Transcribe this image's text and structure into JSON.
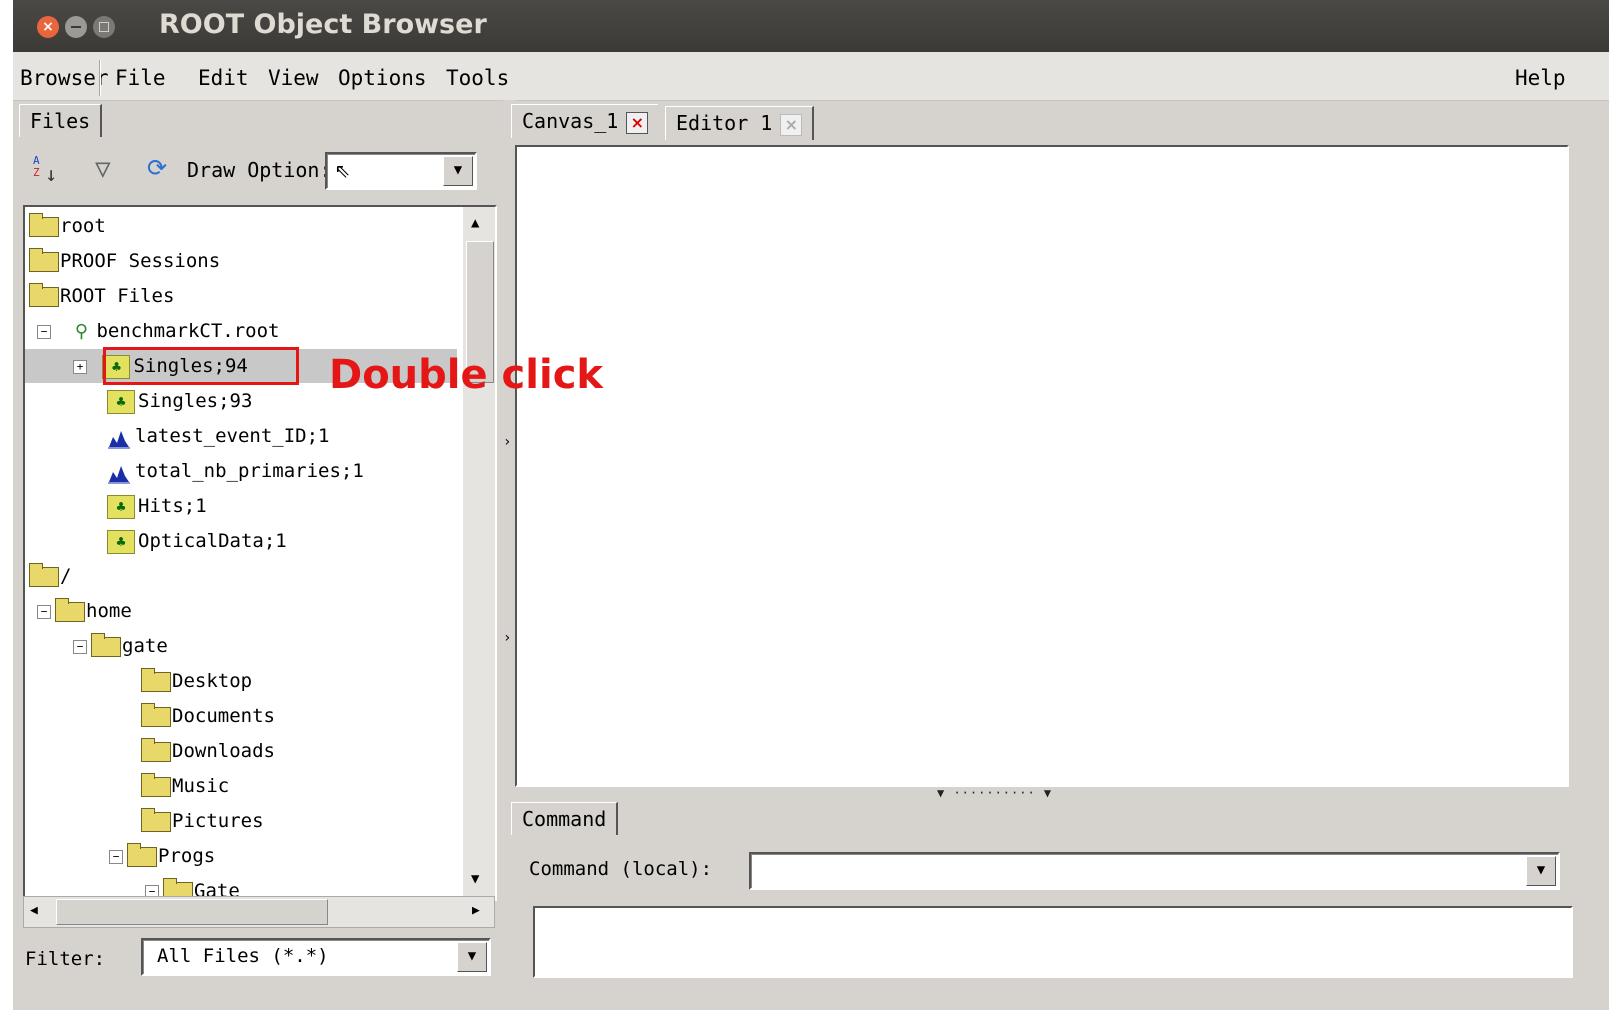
{
  "window": {
    "title": "ROOT Object Browser"
  },
  "menubar": {
    "items": [
      "Browser",
      "File",
      "Edit",
      "View",
      "Options",
      "Tools"
    ],
    "help": "Help"
  },
  "left_panel": {
    "tab": "Files",
    "draw_option_label": "Draw Option:",
    "tree": [
      {
        "label": "root",
        "icon": "folder-icon"
      },
      {
        "label": "PROOF Sessions",
        "icon": "folder-icon"
      },
      {
        "label": "ROOT Files",
        "icon": "folder-open-icon"
      },
      {
        "label": "benchmarkCT.root",
        "icon": "root-file-icon"
      },
      {
        "label": "Singles;94",
        "icon": "tree-icon",
        "selected": true
      },
      {
        "label": "Singles;93",
        "icon": "tree-icon"
      },
      {
        "label": "latest_event_ID;1",
        "icon": "histogram-icon"
      },
      {
        "label": "total_nb_primaries;1",
        "icon": "histogram-icon"
      },
      {
        "label": "Hits;1",
        "icon": "tree-icon"
      },
      {
        "label": "OpticalData;1",
        "icon": "tree-icon"
      },
      {
        "label": "/",
        "icon": "folder-open-icon"
      },
      {
        "label": "home",
        "icon": "folder-open-icon"
      },
      {
        "label": "gate",
        "icon": "folder-open-icon"
      },
      {
        "label": "Desktop",
        "icon": "folder-icon"
      },
      {
        "label": "Documents",
        "icon": "folder-icon"
      },
      {
        "label": "Downloads",
        "icon": "folder-icon"
      },
      {
        "label": "Music",
        "icon": "folder-icon"
      },
      {
        "label": "Pictures",
        "icon": "folder-icon"
      },
      {
        "label": "Progs",
        "icon": "folder-open-icon"
      },
      {
        "label": "Gate",
        "icon": "folder-open-icon"
      }
    ],
    "filter_label": "Filter:",
    "filter_value": "All Files (*.*)"
  },
  "right_panel": {
    "tabs": [
      "Canvas_1",
      "Editor 1"
    ],
    "command_tab": "Command",
    "command_label": "Command (local):"
  },
  "annotation": {
    "text": "Double click",
    "color": "#e41616"
  }
}
